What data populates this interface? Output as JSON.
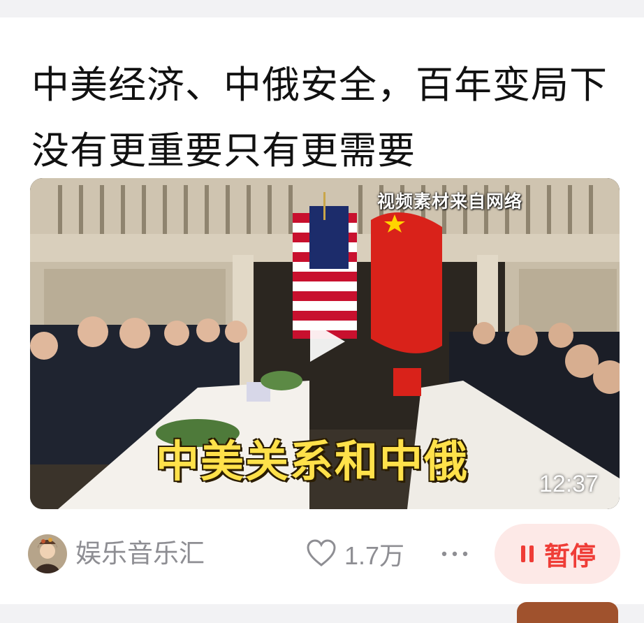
{
  "post": {
    "title": "中美经济、中俄安全，百年变局下没有更重要只有更需要",
    "video": {
      "watermark": "视频素材来自网络",
      "subtitle": "中美关系和中俄",
      "duration": "12:37"
    },
    "author": {
      "name": "娱乐音乐汇"
    },
    "likes": "1.7万",
    "pause_label": "暂停"
  },
  "colors": {
    "accent": "#ef3d37",
    "pause_bg": "#fde9e7",
    "muted_text": "#8e8e93",
    "subtitle_yellow": "#ffe14a"
  },
  "icons": {
    "play": "play-icon",
    "heart": "heart-icon",
    "more": "more-icon",
    "pause": "pause-icon"
  }
}
